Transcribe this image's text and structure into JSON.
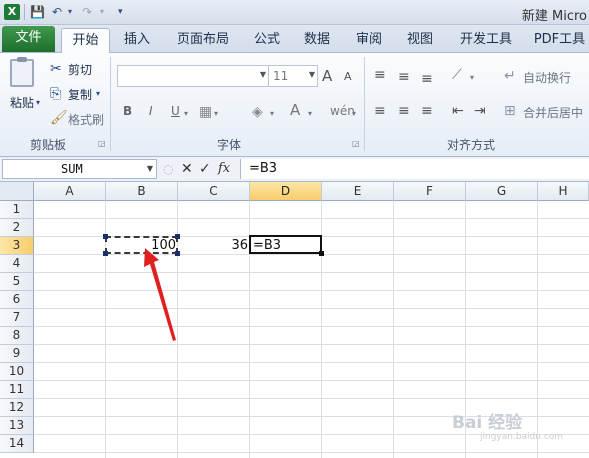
{
  "window": {
    "title": "新建 Micro"
  },
  "tabs": [
    "文件",
    "开始",
    "插入",
    "页面布局",
    "公式",
    "数据",
    "审阅",
    "视图",
    "开发工具",
    "PDF工具"
  ],
  "ribbon": {
    "clipboard": {
      "paste": "粘贴",
      "cut": "剪切",
      "copy": "复制",
      "format_painter": "格式刷",
      "label": "剪贴板"
    },
    "font": {
      "font_size": "11",
      "bold": "B",
      "italic": "I",
      "underline": "U",
      "label": "字体",
      "grow": "A",
      "shrink": "A"
    },
    "alignment": {
      "wrap_text": "自动换行",
      "merge_center": "合并后居中",
      "label": "对齐方式"
    }
  },
  "formula_bar": {
    "name_box": "SUM",
    "cancel": "✕",
    "enter": "✓",
    "fx": "fx",
    "formula": "=B3"
  },
  "columns": [
    "A",
    "B",
    "C",
    "D",
    "E",
    "F",
    "G",
    "H"
  ],
  "rows": [
    "1",
    "2",
    "3",
    "4",
    "5",
    "6",
    "7",
    "8",
    "9",
    "10",
    "11",
    "12",
    "13",
    "14"
  ],
  "cells": {
    "B3": "100",
    "C3": "36",
    "D3": "=B3"
  },
  "watermark": {
    "main": "Bai 经验",
    "sub": "jingyan.baidu.com"
  }
}
